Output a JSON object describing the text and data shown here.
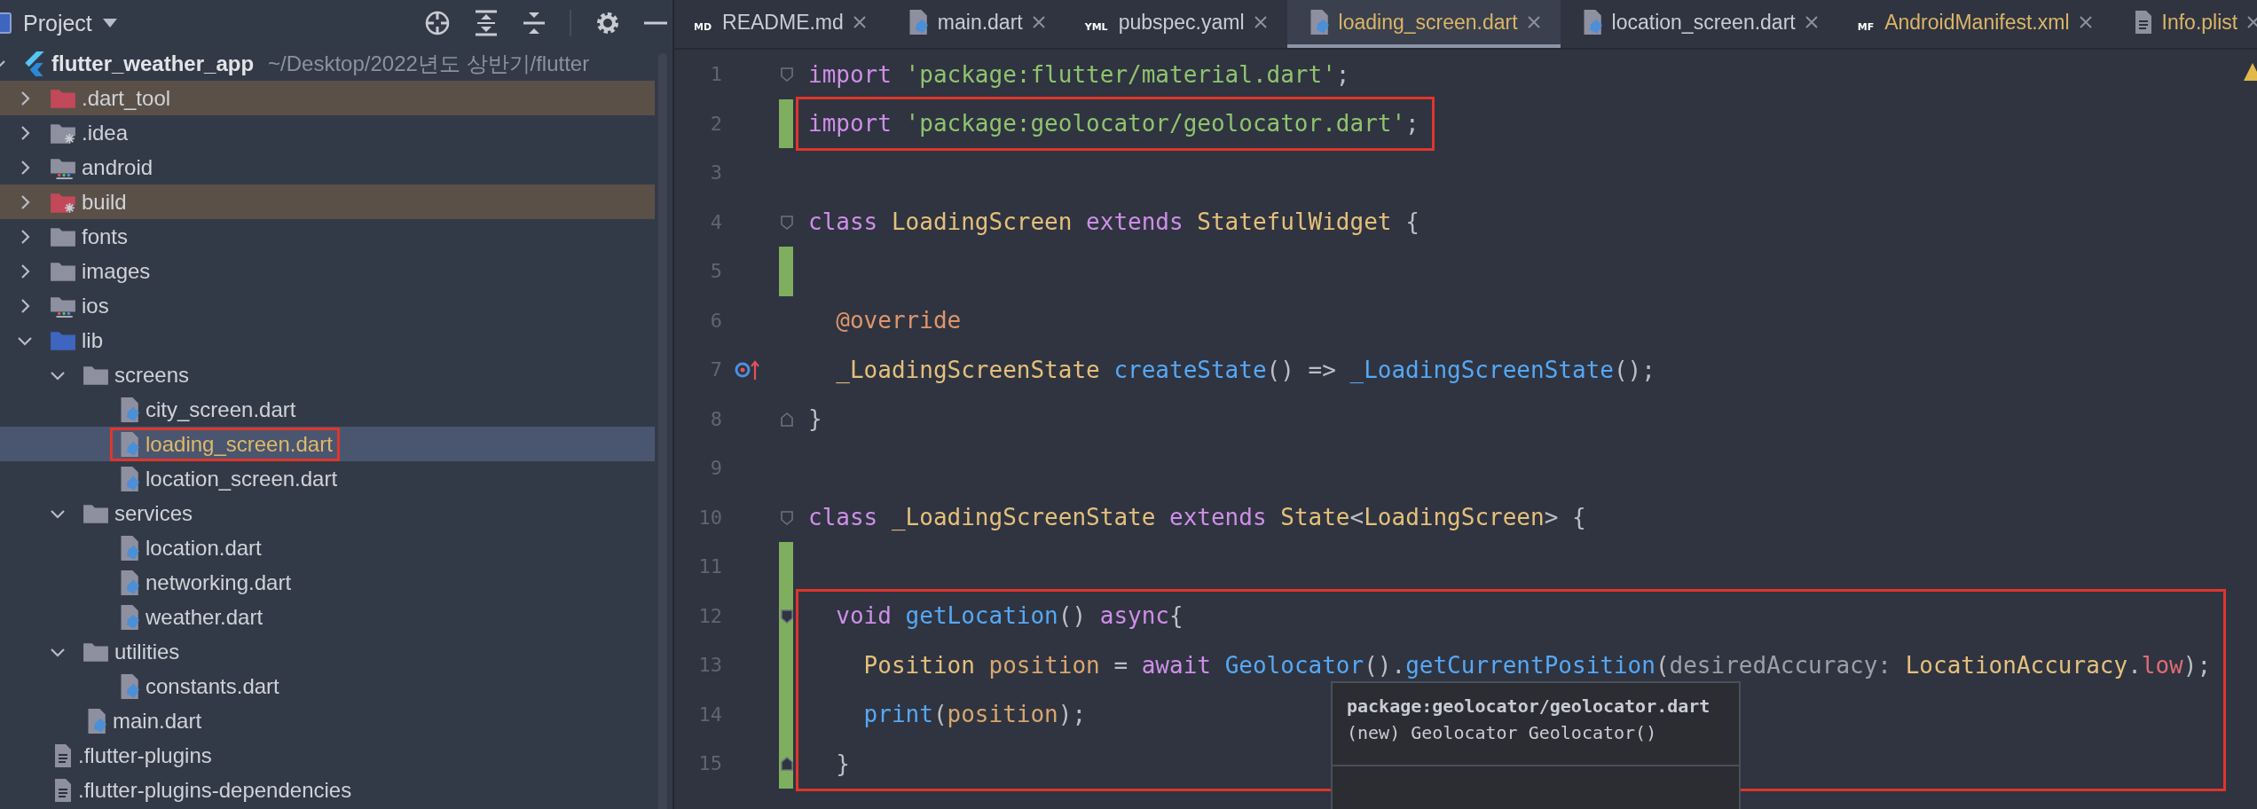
{
  "project_panel": {
    "title": "Project",
    "tree": [
      {
        "label": "flutter_weather_app",
        "path": "~/Desktop/2022년도 상반기/flutter",
        "kind": "project",
        "expanded": true,
        "selected": false,
        "children": [
          {
            "label": ".dart_tool",
            "kind": "excluded-folder",
            "expanded": false,
            "selected": false
          },
          {
            "label": ".idea",
            "kind": "idea-folder",
            "expanded": false,
            "selected": false
          },
          {
            "label": "android",
            "kind": "module-folder",
            "expanded": false,
            "selected": false
          },
          {
            "label": "build",
            "kind": "excluded-idea-folder",
            "expanded": false,
            "selected": false
          },
          {
            "label": "fonts",
            "kind": "folder",
            "expanded": false,
            "selected": false
          },
          {
            "label": "images",
            "kind": "folder",
            "expanded": false,
            "selected": false
          },
          {
            "label": "ios",
            "kind": "module-folder",
            "expanded": false,
            "selected": false
          },
          {
            "label": "lib",
            "kind": "source-folder",
            "expanded": true,
            "selected": false,
            "children": [
              {
                "label": "screens",
                "kind": "folder",
                "expanded": true,
                "selected": false,
                "children": [
                  {
                    "label": "city_screen.dart",
                    "kind": "dart-file",
                    "selected": false,
                    "modified": false
                  },
                  {
                    "label": "loading_screen.dart",
                    "kind": "dart-file",
                    "selected": true,
                    "modified": true,
                    "boxed": true
                  },
                  {
                    "label": "location_screen.dart",
                    "kind": "dart-file",
                    "selected": false,
                    "modified": false
                  }
                ]
              },
              {
                "label": "services",
                "kind": "folder",
                "expanded": true,
                "selected": false,
                "children": [
                  {
                    "label": "location.dart",
                    "kind": "dart-file",
                    "selected": false,
                    "modified": false
                  },
                  {
                    "label": "networking.dart",
                    "kind": "dart-file",
                    "selected": false,
                    "modified": false
                  },
                  {
                    "label": "weather.dart",
                    "kind": "dart-file",
                    "selected": false,
                    "modified": false
                  }
                ]
              },
              {
                "label": "utilities",
                "kind": "folder",
                "expanded": true,
                "selected": false,
                "children": [
                  {
                    "label": "constants.dart",
                    "kind": "dart-file",
                    "selected": false,
                    "modified": false
                  }
                ]
              },
              {
                "label": "main.dart",
                "kind": "dart-file",
                "selected": false,
                "modified": false
              }
            ]
          },
          {
            "label": ".flutter-plugins",
            "kind": "text-file",
            "selected": false,
            "modified": false
          },
          {
            "label": ".flutter-plugins-dependencies",
            "kind": "text-file",
            "selected": false,
            "modified": false
          }
        ]
      }
    ]
  },
  "editor": {
    "tabs": [
      {
        "label": "README.md",
        "kind": "md",
        "badge": "MD",
        "selected": false,
        "modified": false
      },
      {
        "label": "main.dart",
        "kind": "dart",
        "selected": false,
        "modified": false
      },
      {
        "label": "pubspec.yaml",
        "kind": "yml",
        "badge": "YML",
        "selected": false,
        "modified": false
      },
      {
        "label": "loading_screen.dart",
        "kind": "dart",
        "selected": true,
        "modified": true
      },
      {
        "label": "location_screen.dart",
        "kind": "dart",
        "selected": false,
        "modified": false
      },
      {
        "label": "AndroidManifest.xml",
        "kind": "manifest",
        "badge": "MF",
        "selected": false,
        "modified": true
      },
      {
        "label": "Info.plist",
        "kind": "text",
        "selected": false,
        "modified": true
      }
    ],
    "lines": [
      {
        "number": "1",
        "changed": false,
        "fold_open": true,
        "fold_close": false,
        "overridden": false,
        "boxed": false,
        "tokens": [
          {
            "kind": "keyword",
            "text": "import "
          },
          {
            "kind": "string",
            "text": "'package:flutter/material.dart'"
          },
          {
            "kind": "plain",
            "text": ";"
          }
        ]
      },
      {
        "number": "2",
        "changed": true,
        "fold_open": false,
        "fold_close": false,
        "overridden": false,
        "boxed": true,
        "tokens": [
          {
            "kind": "keyword",
            "text": "import "
          },
          {
            "kind": "string",
            "text": "'package:geolocator/geolocator.dart'"
          },
          {
            "kind": "plain",
            "text": ";"
          }
        ]
      },
      {
        "number": "3",
        "changed": false,
        "fold_open": false,
        "fold_close": false,
        "overridden": false,
        "boxed": false
      },
      {
        "number": "4",
        "changed": false,
        "fold_open": true,
        "fold_close": false,
        "overridden": false,
        "boxed": false,
        "tokens": [
          {
            "kind": "keyword",
            "text": "class "
          },
          {
            "kind": "class",
            "text": "LoadingScreen "
          },
          {
            "kind": "keyword",
            "text": "extends "
          },
          {
            "kind": "class",
            "text": "StatefulWidget "
          },
          {
            "kind": "plain",
            "text": "{"
          }
        ]
      },
      {
        "number": "5",
        "changed": true,
        "fold_open": false,
        "fold_close": false,
        "overridden": false,
        "boxed": false
      },
      {
        "number": "6",
        "changed": false,
        "fold_open": false,
        "fold_close": false,
        "overridden": false,
        "boxed": false,
        "tokens": [
          {
            "kind": "annotation",
            "text": "  @override"
          }
        ]
      },
      {
        "number": "7",
        "changed": false,
        "fold_open": false,
        "fold_close": false,
        "overridden": true,
        "boxed": false,
        "tokens": [
          {
            "kind": "class",
            "text": "  _LoadingScreenState "
          },
          {
            "kind": "function",
            "text": "createState"
          },
          {
            "kind": "plain",
            "text": "() => "
          },
          {
            "kind": "function",
            "text": "_LoadingScreenState"
          },
          {
            "kind": "plain",
            "text": "();"
          }
        ]
      },
      {
        "number": "8",
        "changed": false,
        "fold_open": false,
        "fold_close": true,
        "overridden": false,
        "boxed": false,
        "tokens": [
          {
            "kind": "plain",
            "text": "}"
          }
        ]
      },
      {
        "number": "9",
        "changed": false,
        "fold_open": false,
        "fold_close": false,
        "overridden": false,
        "boxed": false
      },
      {
        "number": "10",
        "changed": false,
        "fold_open": true,
        "fold_close": false,
        "overridden": false,
        "boxed": false,
        "tokens": [
          {
            "kind": "keyword",
            "text": "class "
          },
          {
            "kind": "class",
            "text": "_LoadingScreenState "
          },
          {
            "kind": "keyword",
            "text": "extends "
          },
          {
            "kind": "class",
            "text": "State"
          },
          {
            "kind": "plain",
            "text": "<"
          },
          {
            "kind": "class",
            "text": "LoadingScreen"
          },
          {
            "kind": "plain",
            "text": "> {"
          }
        ]
      },
      {
        "number": "11",
        "changed": true,
        "fold_open": false,
        "fold_close": false,
        "overridden": false,
        "boxed": false
      },
      {
        "number": "12",
        "changed": true,
        "fold_open": true,
        "fold_close": false,
        "overridden": false,
        "boxed": true,
        "tokens": [
          {
            "kind": "keyword",
            "text": "  void "
          },
          {
            "kind": "function",
            "text": "getLocation"
          },
          {
            "kind": "plain",
            "text": "() "
          },
          {
            "kind": "keyword",
            "text": "async"
          },
          {
            "kind": "plain",
            "text": "{"
          }
        ]
      },
      {
        "number": "13",
        "changed": true,
        "fold_open": false,
        "fold_close": false,
        "overridden": false,
        "boxed": true,
        "tokens": [
          {
            "kind": "class",
            "text": "    Position "
          },
          {
            "kind": "variable",
            "text": "position "
          },
          {
            "kind": "plain",
            "text": "= "
          },
          {
            "kind": "keyword",
            "text": "await "
          },
          {
            "kind": "function",
            "text": "Geolocator"
          },
          {
            "kind": "plain",
            "text": "()."
          },
          {
            "kind": "function",
            "text": "getCurrentPosition"
          },
          {
            "kind": "plain",
            "text": "("
          },
          {
            "kind": "parameter",
            "text": "desiredAccuracy: "
          },
          {
            "kind": "class",
            "text": "LocationAccuracy"
          },
          {
            "kind": "plain",
            "text": "."
          },
          {
            "kind": "field",
            "text": "low"
          },
          {
            "kind": "plain",
            "text": ");"
          }
        ]
      },
      {
        "number": "14",
        "changed": true,
        "fold_open": false,
        "fold_close": false,
        "overridden": false,
        "boxed": true,
        "tokens": [
          {
            "kind": "function",
            "text": "    print"
          },
          {
            "kind": "plain",
            "text": "("
          },
          {
            "kind": "variable",
            "text": "position"
          },
          {
            "kind": "plain",
            "text": ");"
          }
        ]
      },
      {
        "number": "15",
        "changed": true,
        "fold_open": false,
        "fold_close": true,
        "overridden": false,
        "boxed": true,
        "tokens": [
          {
            "kind": "plain",
            "text": "  }"
          }
        ]
      }
    ],
    "tooltip": {
      "title": "package:geolocator/geolocator.dart",
      "text": "(new) Geolocator Geolocator()"
    }
  }
}
